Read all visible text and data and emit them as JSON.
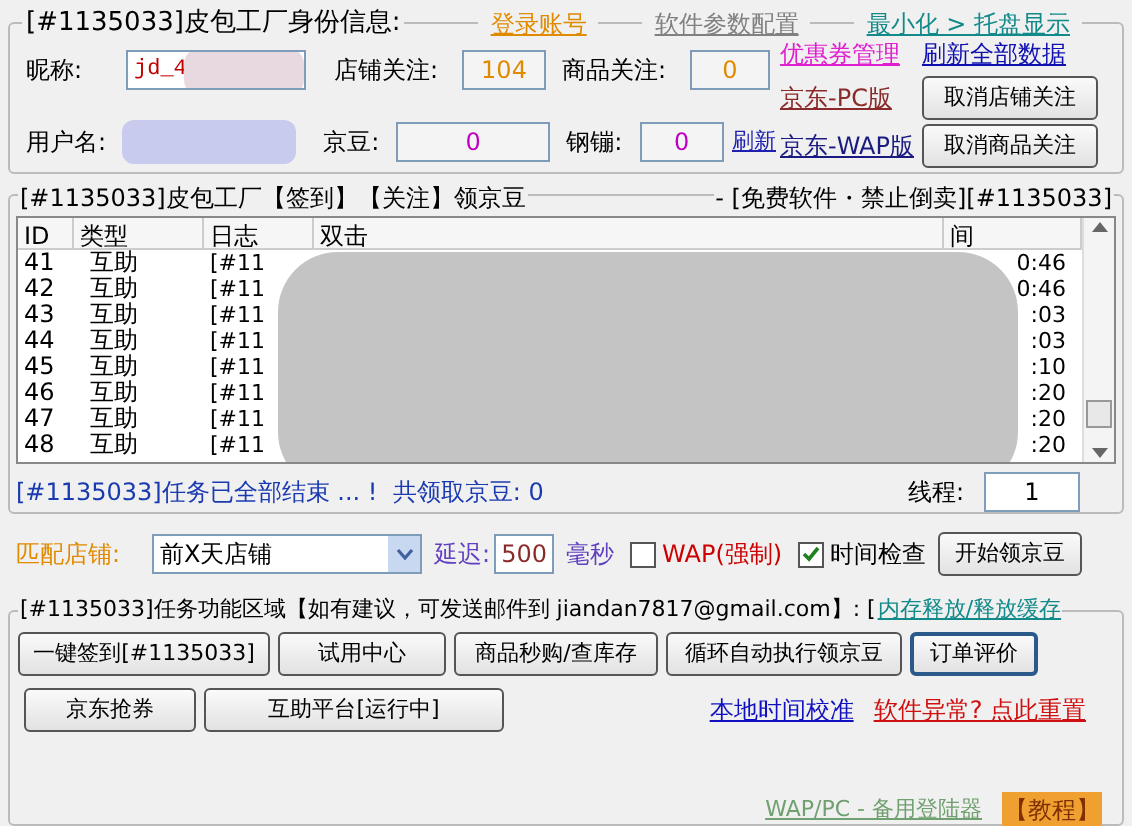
{
  "identity": {
    "title": "[#1135033]皮包工厂身份信息:",
    "header_links": [
      {
        "label": "登录账号",
        "color": "#e08a00"
      },
      {
        "label": "软件参数配置",
        "color": "#808080"
      },
      {
        "label": "最小化 > 托盘显示",
        "color": "#138a8a"
      }
    ],
    "nickname": {
      "label": "昵称:",
      "value": "jd_4"
    },
    "shop_follow": {
      "label": "店铺关注:",
      "value": "104"
    },
    "goods_follow": {
      "label": "商品关注:",
      "value": "0"
    },
    "username": {
      "label": "用户名:"
    },
    "beans": {
      "label": "京豆:",
      "value": "0"
    },
    "coins": {
      "label": "钢镚:",
      "value": "0"
    },
    "refresh_link": "刷新",
    "side_links": [
      {
        "label": "优惠券管理",
        "color": "#e020d0"
      },
      {
        "label": "刷新全部数据",
        "color": "#1010b0"
      },
      {
        "label": "京东-PC版",
        "color": "#8b2a2a"
      },
      {
        "label": "京东-WAP版",
        "color": "#1a1a80"
      }
    ],
    "side_buttons": [
      "取消店铺关注",
      "取消商品关注"
    ]
  },
  "log": {
    "title_left": "[#1135033]皮包工厂【签到】【关注】领京豆",
    "title_right": "- [免费软件・禁止倒卖][#1135033]",
    "columns": [
      "ID",
      "类型",
      "日志",
      "双击",
      "间"
    ],
    "rows": [
      {
        "id": "41",
        "type": "互助",
        "log": "[#11",
        "time": "0:46"
      },
      {
        "id": "42",
        "type": "互助",
        "log": "[#11",
        "time": "0:46"
      },
      {
        "id": "43",
        "type": "互助",
        "log": "[#11",
        "time": ":03"
      },
      {
        "id": "44",
        "type": "互助",
        "log": "[#11",
        "time": ":03"
      },
      {
        "id": "45",
        "type": "互助",
        "log": "[#11",
        "time": ":10"
      },
      {
        "id": "46",
        "type": "互助",
        "log": "[#11",
        "time": ":20"
      },
      {
        "id": "47",
        "type": "互助",
        "log": "[#11",
        "time": ":20"
      },
      {
        "id": "48",
        "type": "互助",
        "log": "[#11",
        "time": ":20"
      }
    ],
    "status": "[#1135033]任务已全部结束 ... !  共领取京豆: 0",
    "threads": {
      "label": "线程:",
      "value": "1"
    }
  },
  "controls": {
    "shop_label": "匹配店铺:",
    "shop_select": "前X天店铺",
    "delay_label": "延迟:",
    "delay_value": "500",
    "delay_unit": "毫秒",
    "checks": [
      {
        "label": "WAP(强制)",
        "checked": false,
        "color": "#cc0000"
      },
      {
        "label": "时间检查",
        "checked": true,
        "color": "#000000"
      }
    ],
    "start_button": "开始领京豆"
  },
  "tasks": {
    "title": "[#1135033]任务功能区域【如有建议，可发送邮件到 jiandan7817@gmail.com】: [",
    "title_link": "内存释放/释放缓存",
    "buttons": [
      {
        "label": "一键签到[#1135033]",
        "default": false
      },
      {
        "label": "试用中心",
        "default": false
      },
      {
        "label": "商品秒购/查库存",
        "default": false
      },
      {
        "label": "循环自动执行领京豆",
        "default": false
      },
      {
        "label": "订单评价",
        "default": true
      }
    ],
    "buttons_row2": [
      {
        "label": "京东抢券",
        "default": false
      },
      {
        "label": "互助平台[运行中]",
        "default": false
      }
    ],
    "links": [
      {
        "label": "本地时间校准",
        "color": "#1010c0"
      },
      {
        "label": "软件异常? 点此重置",
        "color": "#d01010"
      }
    ]
  },
  "footer": {
    "link": "WAP/PC - 备用登陆器",
    "tutorial": "【教程】"
  }
}
